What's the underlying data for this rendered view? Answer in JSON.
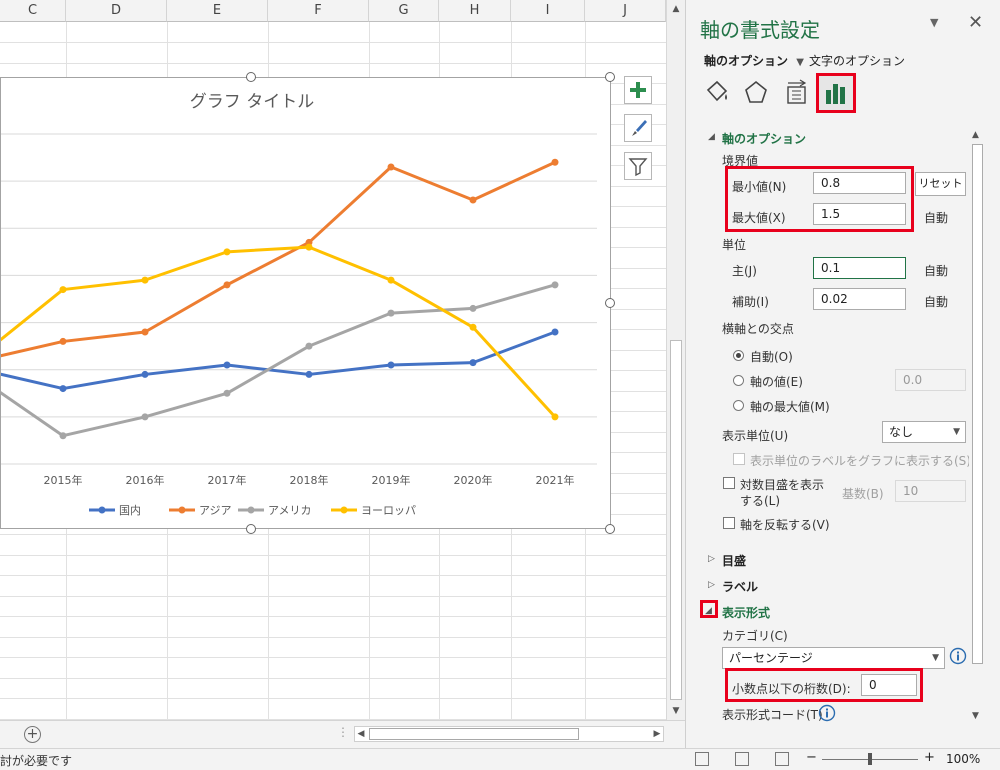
{
  "sheet": {
    "columns": [
      "C",
      "D",
      "E",
      "F",
      "G",
      "H",
      "I",
      "J"
    ]
  },
  "chart": {
    "buttons": {
      "add_icon": "plus-icon",
      "style_icon": "brush-icon",
      "filter_icon": "filter-icon"
    }
  },
  "chart_data": {
    "type": "line",
    "title": "グラフ タイトル",
    "categories": [
      "2015年",
      "2016年",
      "2017年",
      "2018年",
      "2019年",
      "2020年",
      "2021年"
    ],
    "ylim": [
      0.8,
      1.5
    ],
    "grid": true,
    "legend": "bottom",
    "series": [
      {
        "name": "国内",
        "color": "#4472c4",
        "first": 1.0,
        "values": [
          0.96,
          0.99,
          1.01,
          0.99,
          1.01,
          1.015,
          1.08
        ]
      },
      {
        "name": "アジア",
        "color": "#ed7d31",
        "first": 1.02,
        "values": [
          1.06,
          1.08,
          1.18,
          1.27,
          1.43,
          1.36,
          1.44
        ]
      },
      {
        "name": "アメリカ",
        "color": "#a5a5a5",
        "first": 0.98,
        "values": [
          0.86,
          0.9,
          0.95,
          1.05,
          1.12,
          1.13,
          1.18
        ]
      },
      {
        "name": "ヨーロッパ",
        "color": "#ffc000",
        "first": 1.03,
        "values": [
          1.17,
          1.19,
          1.25,
          1.26,
          1.19,
          1.09,
          0.9
        ]
      }
    ]
  },
  "pane": {
    "title": "軸の書式設定",
    "tab_axis_options": "軸のオプション",
    "tab_text_options": "文字のオプション",
    "icon_tabs": [
      "fill-line-icon",
      "effects-icon",
      "size-properties-icon",
      "axis-options-icon"
    ],
    "section_axis_options": "軸のオプション",
    "bounds_label": "境界値",
    "min_label": "最小値(N)",
    "min_value": "0.8",
    "reset_label": "リセット",
    "max_label": "最大値(X)",
    "max_value": "1.5",
    "max_auto": "自動",
    "units_label": "単位",
    "major_label": "主(J)",
    "major_value": "0.1",
    "major_auto": "自動",
    "minor_label": "補助(I)",
    "minor_value": "0.02",
    "minor_auto": "自動",
    "crosses_label": "横軸との交点",
    "radio_auto": "自動(O)",
    "radio_axis_value": "軸の値(E)",
    "axis_value_input": "0.0",
    "radio_max": "軸の最大値(M)",
    "display_units_label": "表示単位(U)",
    "display_units_value": "なし",
    "show_units_label": "表示単位のラベルをグラフに表示する(S)",
    "log_scale_label_1": "対数目盛を表示",
    "log_scale_label_2": "する(L)",
    "base_label": "基数(B)",
    "base_value": "10",
    "reverse_label": "軸を反転する(V)",
    "section_ticks": "目盛",
    "section_labels": "ラベル",
    "section_number": "表示形式",
    "category_label": "カテゴリ(C)",
    "category_value": "パーセンテージ",
    "decimals_label": "小数点以下の桁数(D):",
    "decimals_value": "0",
    "format_code_label": "表示形式コード(T)"
  },
  "status": {
    "text": "討が必要です",
    "zoom": "100%"
  }
}
